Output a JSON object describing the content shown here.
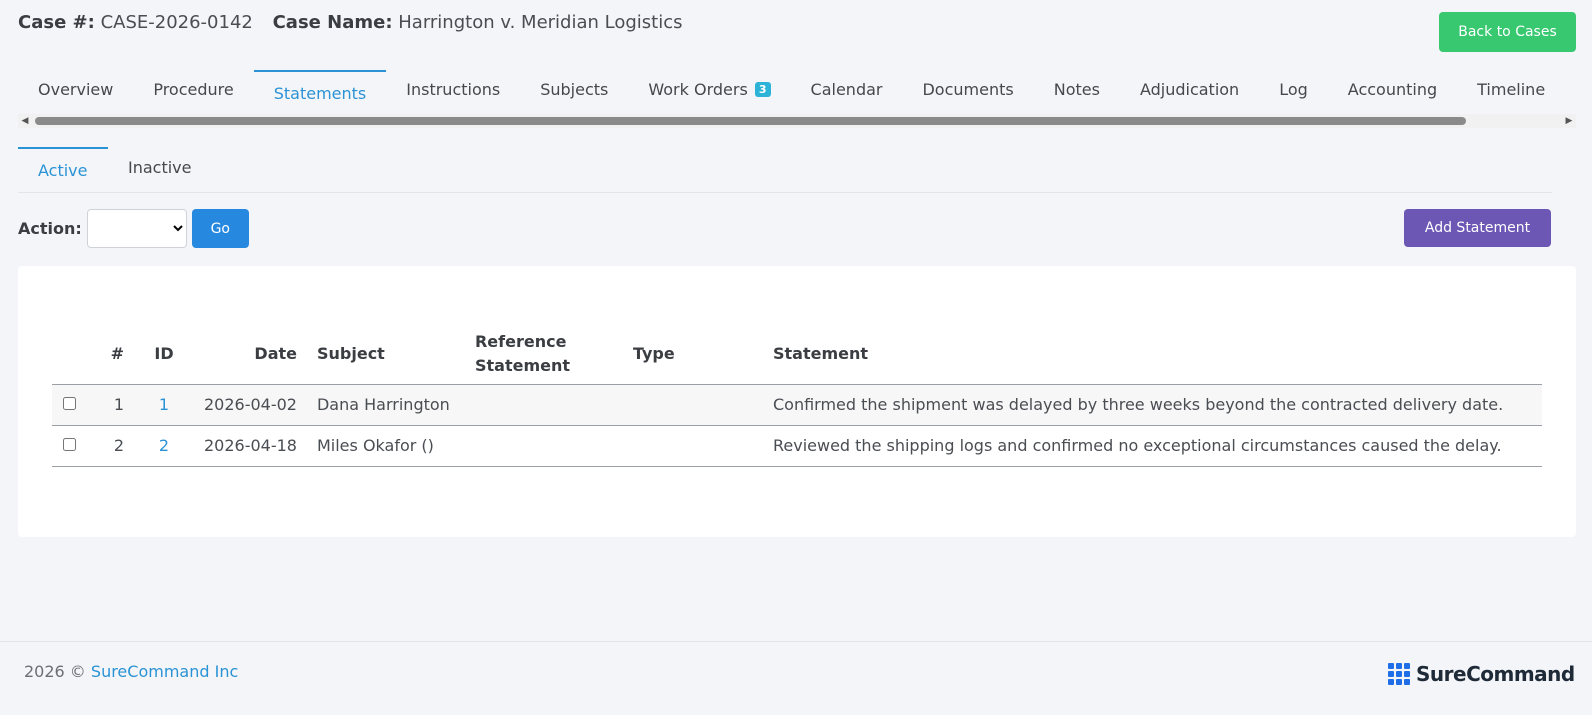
{
  "header": {
    "case_num_label": "Case #:",
    "case_num_value": "CASE-2026-0142",
    "case_name_label": "Case Name:",
    "case_name_value": "Harrington v. Meridian Logistics",
    "back_label": "Back to Cases"
  },
  "tabs": [
    {
      "label": "Overview"
    },
    {
      "label": "Procedure"
    },
    {
      "label": "Statements",
      "active": true
    },
    {
      "label": "Instructions"
    },
    {
      "label": "Subjects"
    },
    {
      "label": "Work Orders",
      "badge": "3"
    },
    {
      "label": "Calendar"
    },
    {
      "label": "Documents"
    },
    {
      "label": "Notes"
    },
    {
      "label": "Adjudication"
    },
    {
      "label": "Log"
    },
    {
      "label": "Accounting"
    },
    {
      "label": "Timeline"
    }
  ],
  "subtabs": [
    {
      "label": "Active",
      "active": true
    },
    {
      "label": "Inactive"
    }
  ],
  "actions": {
    "label": "Action:",
    "select_value": "",
    "go_label": "Go",
    "add_label": "Add Statement"
  },
  "table": {
    "headers": {
      "num": "#",
      "id": "ID",
      "date": "Date",
      "subject": "Subject",
      "reference_line1": "Reference",
      "reference_line2": "Statement",
      "type": "Type",
      "statement": "Statement"
    },
    "rows": [
      {
        "num": "1",
        "id": "1",
        "date": "2026-04-02",
        "subject": "Dana Harrington",
        "reference": "",
        "type": "",
        "statement": "Confirmed the shipment was delayed by three weeks beyond the contracted delivery date."
      },
      {
        "num": "2",
        "id": "2",
        "date": "2026-04-18",
        "subject": "Miles Okafor ()",
        "reference": "",
        "type": "",
        "statement": "Reviewed the shipping logs and confirmed no exceptional circumstances caused the delay."
      }
    ]
  },
  "footer": {
    "year": "2026 ©",
    "company": "SureCommand Inc",
    "brand": "SureCommand"
  },
  "colors": {
    "accent": "#2a93d5",
    "back_button": "#37c870",
    "add_button": "#6c57b4",
    "go_button": "#2689df",
    "brand": "#1f6ee8"
  }
}
